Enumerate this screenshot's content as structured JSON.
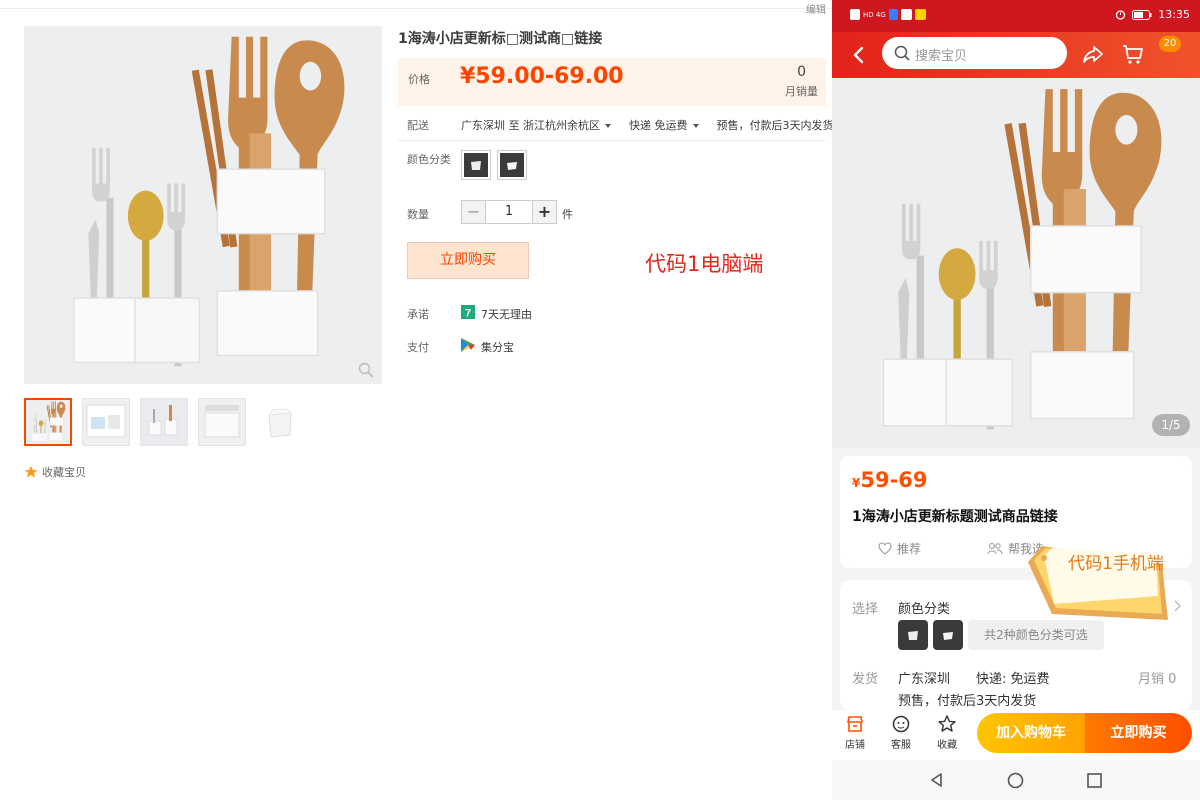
{
  "pc": {
    "edit_label": "编辑",
    "title": "1海涛小店更新标□测试商□链接",
    "price_label": "价格",
    "price": "¥59.00-69.00",
    "monthly_sales": "0",
    "monthly_sales_label": "月销量",
    "delivery_label": "配送",
    "delivery_from": "广东深圳 至  浙江杭州余杭区",
    "delivery_express": "快递 免运费",
    "delivery_presale": "预售，付款后3天内发货",
    "color_label": "颜色分类",
    "qty_label": "数量",
    "qty_minus": "−",
    "qty_value": "1",
    "qty_plus": "+",
    "qty_unit": "件",
    "buy_button": "立即购买",
    "red_note": "代码1电脑端",
    "promise_label": "承诺",
    "promise_icon_text": "7",
    "promise_text": "7天无理由",
    "pay_label": "支付",
    "pay_text": "集分宝",
    "favorite_label": "收藏宝贝"
  },
  "mobile": {
    "status_time": "13:35",
    "status_left": "HD 4G",
    "search_placeholder": "搜索宝贝",
    "cart_badge": "20",
    "pager": "1/5",
    "price_yen": "¥",
    "price": "59-69",
    "title": "1海涛小店更新标题测试商品链接",
    "action_recommend": "推荐",
    "action_help": "帮我选",
    "select_label": "选择",
    "select_value": "颜色分类",
    "more_colors": "共2种颜色分类可选",
    "ship_label": "发货",
    "ship_from": "广东深圳",
    "ship_express": "快递: 免运费",
    "ship_sales": "月销 0",
    "ship_presale": "预售，付款后3天内发货",
    "sticker_text": "代码1手机端",
    "tab_store": "店铺",
    "tab_service": "客服",
    "tab_favorite": "收藏",
    "add_to_cart": "加入购物车",
    "buy_now": "立即购买"
  },
  "colors": {
    "accent": "#ff4400",
    "price_bg": "#fff2e8",
    "mobile_header": "#e2231a",
    "red_note": "#e4261d",
    "add_cart": "#ffb400",
    "buy_now": "#ff5a00"
  },
  "icons": [
    "zoom-icon",
    "star-icon",
    "back-icon",
    "search-icon",
    "share-icon",
    "cart-icon",
    "heart-icon",
    "people-icon",
    "chevron-right-icon",
    "store-icon",
    "service-icon",
    "favorite-star-icon",
    "nav-back-icon",
    "nav-home-icon",
    "nav-recents-icon"
  ]
}
